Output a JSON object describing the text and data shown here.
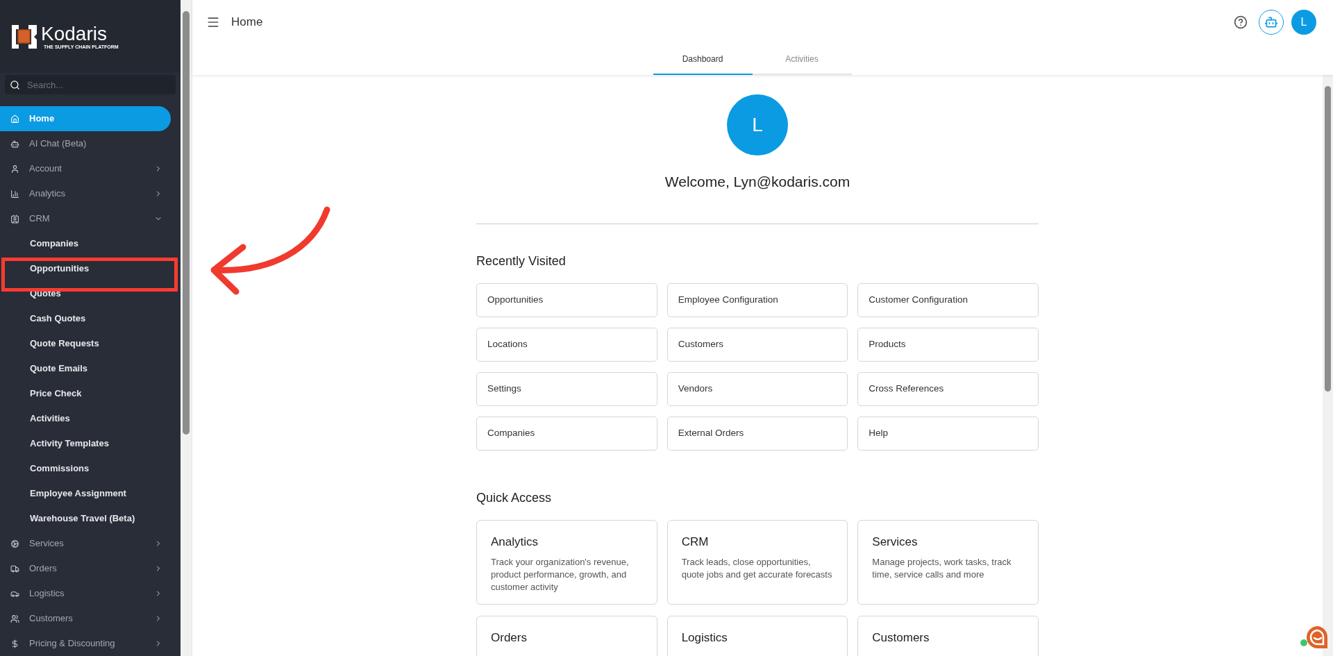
{
  "logo": {
    "name": "Kodaris",
    "tagline": "THE SUPPLY CHAIN PLATFORM"
  },
  "sidebar": {
    "search": {
      "placeholder": "Search..."
    },
    "items": [
      {
        "label": "Home",
        "selected": true
      },
      {
        "label": "AI Chat (Beta)",
        "selected": false
      },
      {
        "label": "Account",
        "selected": false,
        "expanded": false
      },
      {
        "label": "Analytics",
        "selected": false,
        "expanded": false
      },
      {
        "label": "CRM",
        "selected": false,
        "expanded": true,
        "children": [
          {
            "label": "Companies",
            "selected": false
          },
          {
            "label": "Opportunities",
            "selected": false
          },
          {
            "label": "Quotes",
            "selected": false
          },
          {
            "label": "Cash Quotes",
            "selected": false
          },
          {
            "label": "Quote Requests",
            "selected": false
          },
          {
            "label": "Quote Emails",
            "selected": false
          },
          {
            "label": "Price Check",
            "selected": false
          },
          {
            "label": "Activities",
            "selected": false
          },
          {
            "label": "Activity Templates",
            "selected": false
          },
          {
            "label": "Commissions",
            "selected": false
          },
          {
            "label": "Employee Assignment",
            "selected": false
          },
          {
            "label": "Warehouse Travel (Beta)",
            "selected": false
          }
        ]
      },
      {
        "label": "Services",
        "selected": false,
        "expanded": false
      },
      {
        "label": "Orders",
        "selected": false,
        "expanded": false
      },
      {
        "label": "Logistics",
        "selected": false,
        "expanded": false
      },
      {
        "label": "Customers",
        "selected": false,
        "expanded": false
      },
      {
        "label": "Pricing & Discounting",
        "selected": false,
        "expanded": false
      }
    ]
  },
  "header": {
    "title": "Home",
    "avatar": "L"
  },
  "tabs": [
    {
      "label": "Dashboard",
      "selected": true
    },
    {
      "label": "Activities",
      "selected": false
    }
  ],
  "welcome": {
    "avatar": "L",
    "text": "Welcome, Lyn@kodaris.com"
  },
  "recently_visited": {
    "title": "Recently Visited",
    "items": [
      "Opportunities",
      "Employee Configuration",
      "Customer Configuration",
      "Locations",
      "Customers",
      "Products",
      "Settings",
      "Vendors",
      "Cross References",
      "Companies",
      "External Orders",
      "Help"
    ]
  },
  "quick_access": {
    "title": "Quick Access",
    "cards": [
      {
        "title": "Analytics",
        "description": "Track your organization's revenue, product performance, growth, and customer activity"
      },
      {
        "title": "CRM",
        "description": "Track leads, close opportunities, quote jobs and get accurate forecasts"
      },
      {
        "title": "Services",
        "description": "Manage projects, work tasks, track time, service calls and more"
      },
      {
        "title": "Orders"
      },
      {
        "title": "Logistics"
      },
      {
        "title": "Customers"
      }
    ]
  }
}
